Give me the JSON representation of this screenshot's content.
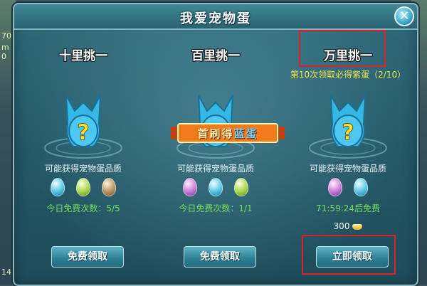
{
  "dialog": {
    "title": "我爱宠物蛋"
  },
  "close_icon": "close-icon",
  "edge": {
    "left_top": "70",
    "left_mid": "m 0",
    "left_bottom": "14"
  },
  "columns": [
    {
      "title": "十里挑一",
      "quality_label": "可能获得宠物蛋品质",
      "eggs": [
        "blue",
        "green",
        "brown"
      ],
      "free_count": "今日免费次数：5/5",
      "button_label": "免费领取"
    },
    {
      "title": "百里挑一",
      "quality_label": "可能获得宠物蛋品质",
      "eggs": [
        "purple",
        "blue",
        "green"
      ],
      "free_count": "今日免费次数：1/1",
      "button_label": "免费领取"
    },
    {
      "title": "万里挑一",
      "guarantee": "第10次领取必得紫蛋（2/10）",
      "quality_label": "可能获得宠物蛋品质",
      "eggs": [
        "purple",
        "blue"
      ],
      "free_count": "71:59:24后免费",
      "price": "300",
      "button_label": "立即领取"
    }
  ],
  "ribbon": {
    "text_before": "首刷得",
    "text_highlight": "蓝蛋"
  },
  "colors": {
    "accent_yellow": "#f3e24a",
    "free_green": "#6fe05c",
    "highlight_red": "#e0202a"
  }
}
